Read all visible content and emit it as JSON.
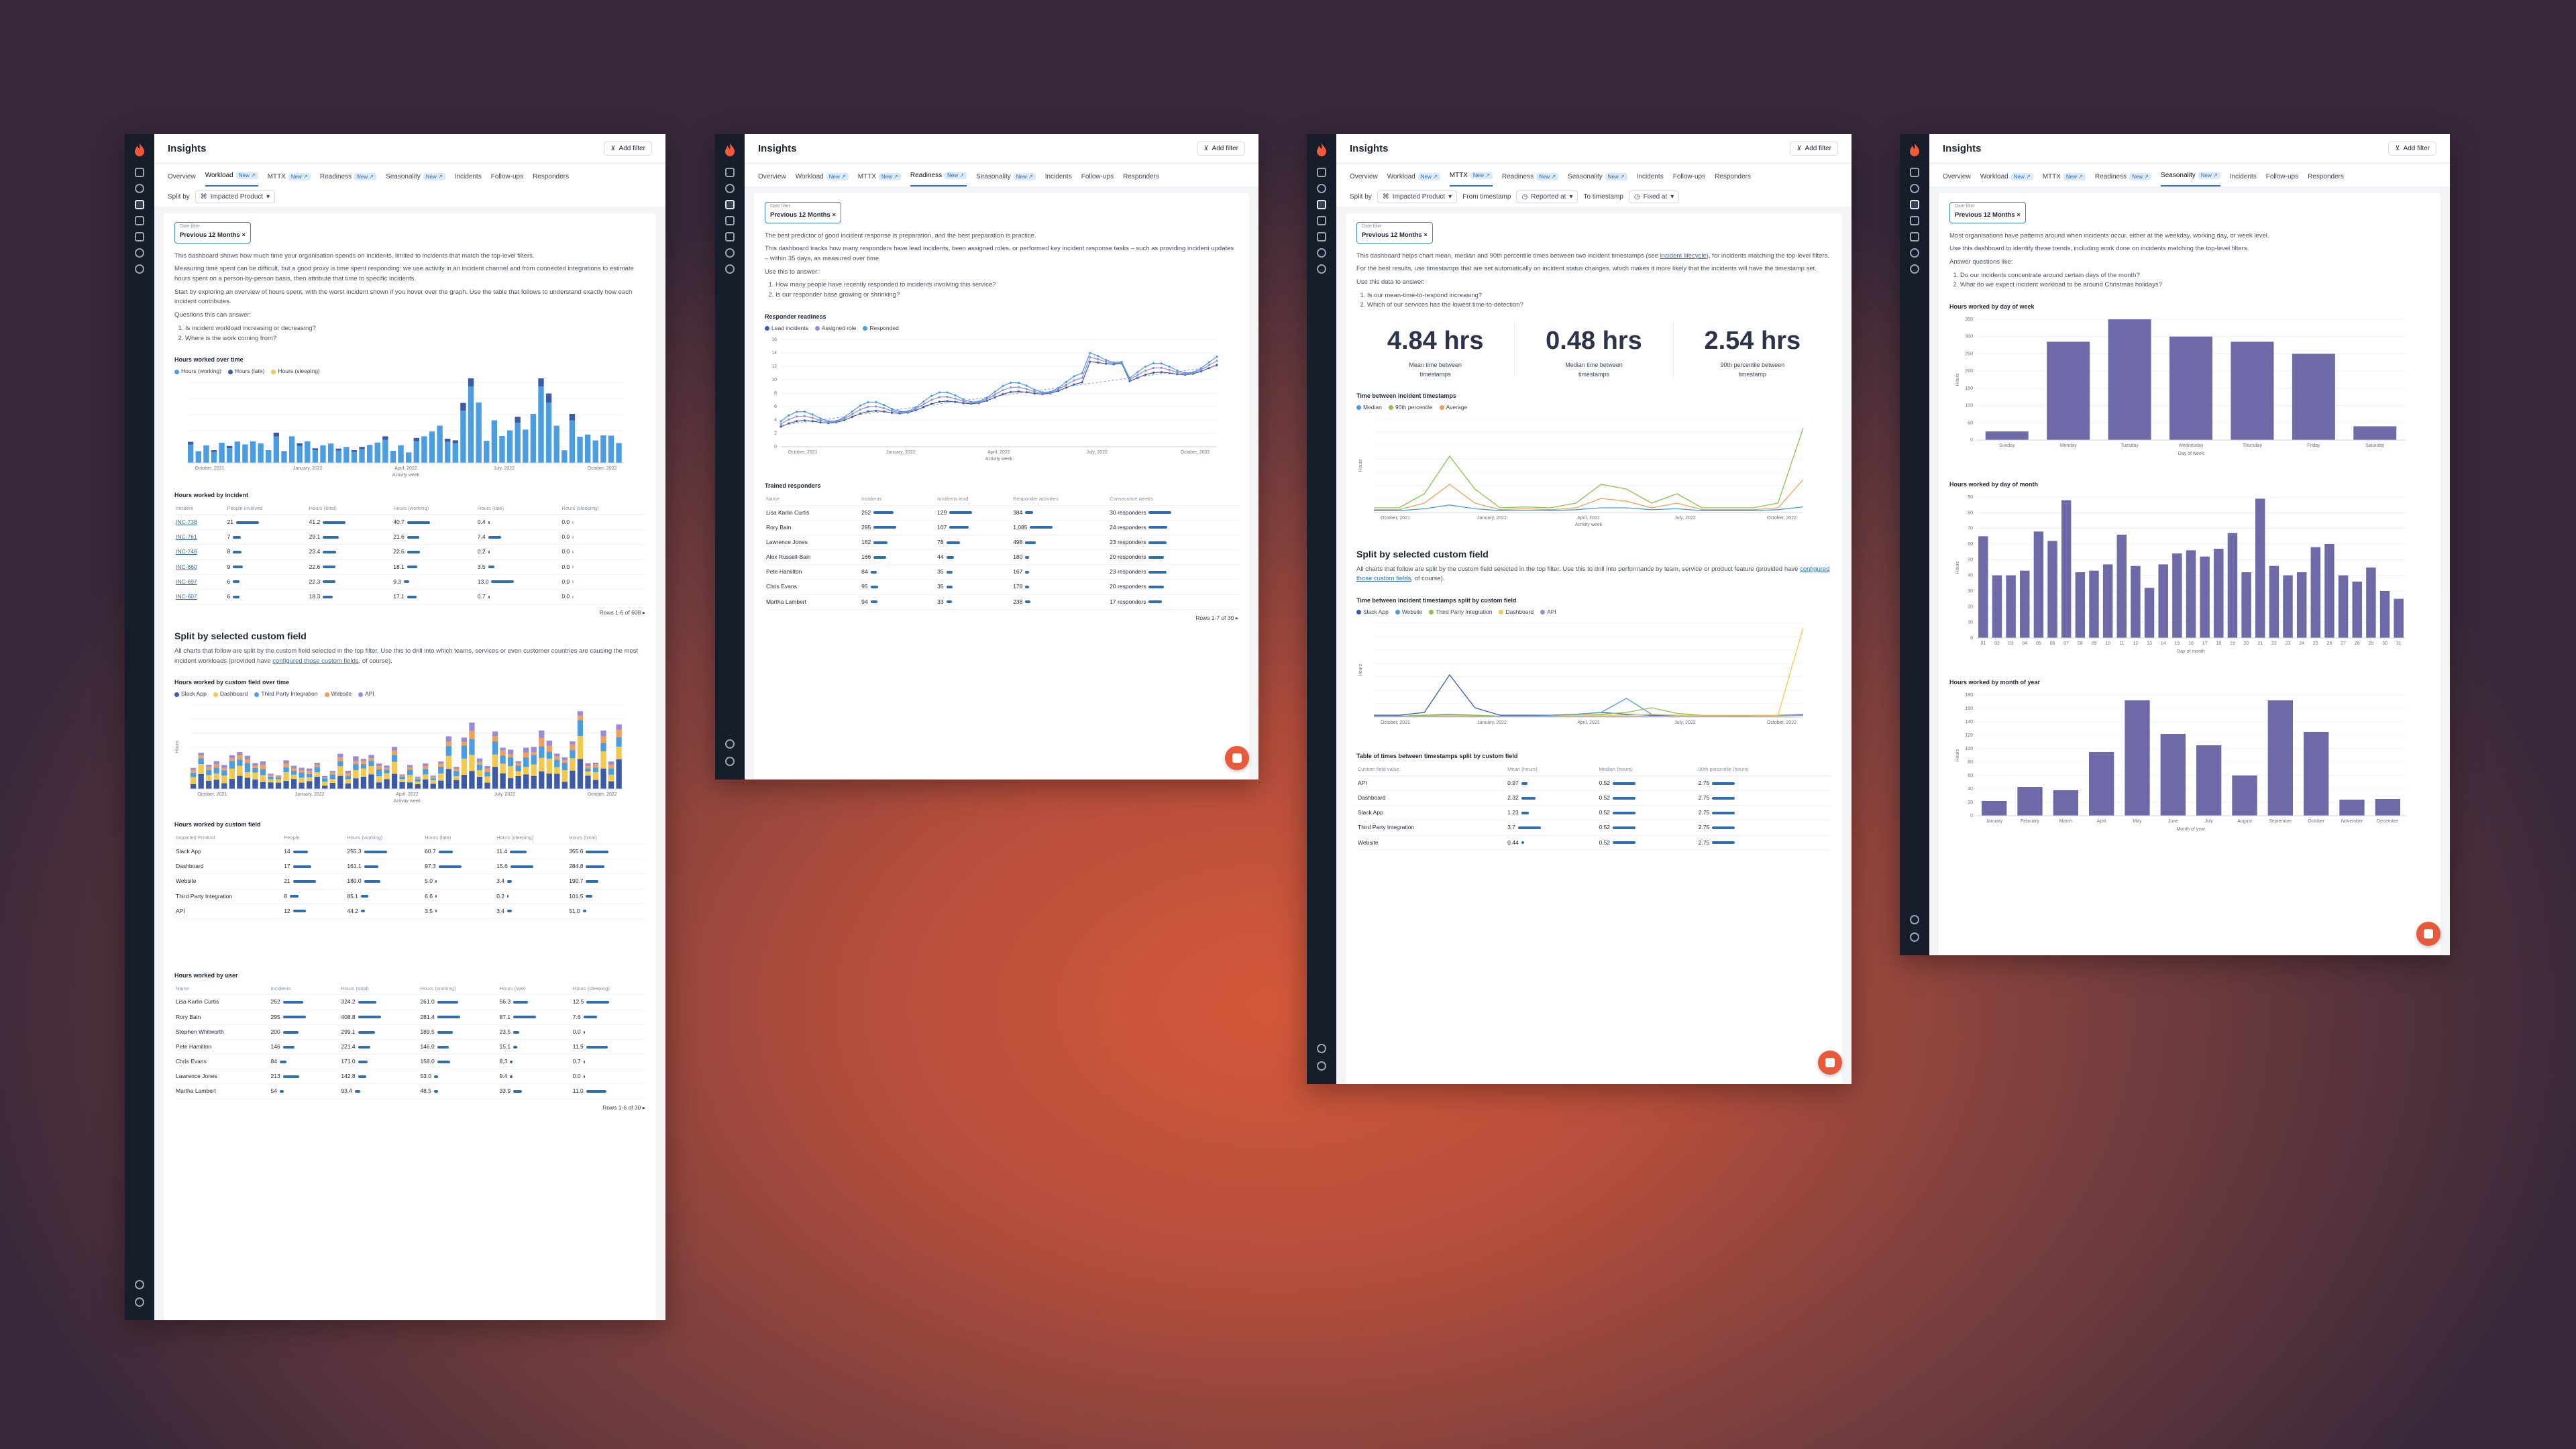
{
  "app": {
    "title": "Insights",
    "add_filter": "Add filter",
    "new_badge": "New ↗",
    "date_filter_label": "Date filter",
    "date_filter_value": "Previous 12 Months"
  },
  "tabs": [
    "Overview",
    "Workload",
    "MTTX",
    "Readiness",
    "Seasonality",
    "Incidents",
    "Follow-ups",
    "Responders"
  ],
  "tabs_new": [
    false,
    true,
    true,
    true,
    true,
    false,
    false,
    false
  ],
  "workload": {
    "split_by_label": "Split by",
    "split_by_value": "Impacted Product",
    "intro": [
      "This dashboard shows how much time your organisation spends on incidents, limited to incidents that match the top-level filters.",
      "Measuring time spent can be difficult, but a good proxy is time spent responding: we use activity in an incident channel and from connected integrations to estimate hours spent on a person-by-person basis, then attribute that time to specific incidents.",
      "Start by exploring an overview of hours spent, with the worst incident shown if you hover over the graph. Use the table that follows to understand exactly how each incident contributes.",
      "Questions this can answer:"
    ],
    "questions": [
      "Is incident workload increasing or decreasing?",
      "Where is the work coming from?"
    ],
    "hours_chart": {
      "title": "Hours worked over time",
      "legend": [
        "Hours (working)",
        "Hours (late)",
        "Hours (sleeping)"
      ],
      "xlabel": "Activity week",
      "xticks": [
        "October, 2021",
        "January, 2022",
        "April, 2022",
        "July, 2022",
        "October, 2022"
      ]
    },
    "incident_table": {
      "title": "Hours worked by incident",
      "cols": [
        "Incident",
        "People involved",
        "Hours (total)",
        "Hours (working)",
        "Hours (late)",
        "Hours (sleeping)"
      ],
      "rows": [
        [
          "INC-738",
          "21",
          "41.2",
          "40.7",
          "0.4",
          "0.0"
        ],
        [
          "INC-761",
          "7",
          "29.1",
          "21.6",
          "7.4",
          "0.0"
        ],
        [
          "INC-748",
          "8",
          "23.4",
          "22.6",
          "0.2",
          "0.0"
        ],
        [
          "INC-660",
          "9",
          "22.6",
          "18.1",
          "3.5",
          "0.0"
        ],
        [
          "INC-697",
          "6",
          "22.3",
          "9.3",
          "13.0",
          "0.0"
        ],
        [
          "INC-607",
          "6",
          "18.3",
          "17.1",
          "0.7",
          "0.0"
        ]
      ],
      "pager": "Rows 1-6 of 608"
    },
    "custom_title": "Split by selected custom field",
    "custom_text_a": "All charts that follow are split by the custom field selected in the top filter. Use this to drill into which teams, services or even customer countries are causing the most incident workloads (provided have ",
    "custom_link": "configured those custom fields",
    "custom_text_b": ", of course).",
    "custom_chart": {
      "title": "Hours worked by custom field over time",
      "legend": [
        "Slack App",
        "Dashboard",
        "Third Party Integration",
        "Website",
        "API"
      ],
      "ylabel": "Hours",
      "xlabel": "Activity week",
      "xticks": [
        "October, 2021",
        "January, 2022",
        "April, 2022",
        "July, 2022",
        "October, 2022"
      ]
    },
    "cf_table": {
      "title": "Hours worked by custom field",
      "cols": [
        "Impacted Product",
        "People",
        "Hours (working)",
        "Hours (late)",
        "Hours (sleeping)",
        "Hours (total)"
      ],
      "rows": [
        [
          "Slack App",
          "14",
          "255.3",
          "60.7",
          "11.4",
          "355.6"
        ],
        [
          "Dashboard",
          "17",
          "161.1",
          "97.3",
          "15.6",
          "284.8"
        ],
        [
          "Website",
          "21",
          "180.0",
          "5.0",
          "3.4",
          "190.7"
        ],
        [
          "Third Party Integration",
          "8",
          "85.1",
          "6.6",
          "0.2",
          "101.5"
        ],
        [
          "API",
          "12",
          "44.2",
          "3.5",
          "3.4",
          "51.0"
        ]
      ]
    },
    "user_table": {
      "title": "Hours worked by user",
      "cols": [
        "Name",
        "Incidents",
        "Hours (total)",
        "Hours (working)",
        "Hours (late)",
        "Hours (sleeping)"
      ],
      "rows": [
        [
          "Lisa Karlin Curtis",
          "262",
          "324.2",
          "261.0",
          "56.3",
          "12.5"
        ],
        [
          "Rory Bain",
          "295",
          "408.8",
          "281.4",
          "87.1",
          "7.6"
        ],
        [
          "Stephen Whitworth",
          "200",
          "299.1",
          "189.5",
          "23.5",
          "0.0"
        ],
        [
          "Pete Hamilton",
          "146",
          "221.4",
          "146.0",
          "15.1",
          "11.9"
        ],
        [
          "Chris Evans",
          "84",
          "171.0",
          "158.0",
          "8.3",
          "0.7"
        ],
        [
          "Lawrence Jones",
          "213",
          "142.8",
          "53.0",
          "9.4",
          "0.0"
        ],
        [
          "Martha Lambert",
          "54",
          "93.4",
          "48.5",
          "33.9",
          "11.0"
        ]
      ],
      "pager": "Rows 1-6 of 30"
    }
  },
  "readiness": {
    "intro": [
      "The best predictor of good incident response is preparation, and the best preparation is practice.",
      "This dashboard tracks how many responders have lead incidents, been assigned roles, or performed key incident response tasks – such as providing incident updates – within 35 days, as measured over time.",
      "Use this to answer:"
    ],
    "questions": [
      "How many people have recently responded to incidents involving this service?",
      "Is our responder base growing or shrinking?"
    ],
    "chart": {
      "title": "Responder readiness",
      "legend": [
        "Lead incidents",
        "Assigned role",
        "Responded"
      ],
      "xlabel": "Activity week",
      "xticks": [
        "October, 2021",
        "January, 2022",
        "April, 2022",
        "July, 2022",
        "October, 2022"
      ],
      "yticks": [
        "0",
        "2",
        "4",
        "6",
        "8",
        "10",
        "12",
        "14",
        "16"
      ]
    },
    "table": {
      "title": "Trained responders",
      "cols": [
        "Name",
        "Incidents",
        "Incidents lead",
        "Responder activities",
        "Consecutive weeks"
      ],
      "rows": [
        [
          "Lisa Karlin Curtis",
          "262",
          "129",
          "384",
          "30 responders"
        ],
        [
          "Rory Bain",
          "295",
          "107",
          "1,085",
          "24 responders"
        ],
        [
          "Lawrence Jones",
          "182",
          "78",
          "498",
          "23 responders"
        ],
        [
          "Alex Russell-Bain",
          "166",
          "44",
          "180",
          "20 responders"
        ],
        [
          "Pete Hamilton",
          "84",
          "35",
          "167",
          "23 responders"
        ],
        [
          "Chris Evans",
          "95",
          "35",
          "178",
          "20 responders"
        ],
        [
          "Martha Lambert",
          "94",
          "33",
          "238",
          "17 responders"
        ]
      ],
      "pager": "Rows 1-7 of 30"
    }
  },
  "mttx": {
    "split_by_label": "Split by",
    "split_by_value": "Impacted Product",
    "from_label": "From timestamp",
    "from_value": "Reported at",
    "to_label": "To timestamp",
    "to_value": "Fixed at",
    "intro_a": "This dashboard helps chart mean, median and 90th percentile times between two incident timestamps (see ",
    "intro_link": "incident lifecycle",
    "intro_b": "), for incidents matching the top-level filters.",
    "intro2": [
      "For the best results, use timestamps that are set automatically on incident status changes, which makes it more likely that the incidents will have the timestamp set.",
      "Use this data to answer:"
    ],
    "questions": [
      "Is our mean-time-to-respond increasing?",
      "Which of our services has the lowest time-to-detection?"
    ],
    "big": [
      {
        "v": "4.84 hrs",
        "l": "Mean time between timestamps"
      },
      {
        "v": "0.48 hrs",
        "l": "Median time between timestamps"
      },
      {
        "v": "2.54 hrs",
        "l": "90th percentile between timestamp"
      }
    ],
    "chart1": {
      "title": "Time between incident timestamps",
      "legend": [
        "Median",
        "90th percentile",
        "Average"
      ],
      "ylabel": "Hours",
      "xlabel": "Activity week",
      "xticks": [
        "October, 2021",
        "January, 2022",
        "April, 2022",
        "July, 2022",
        "October, 2022"
      ]
    },
    "custom_title": "Split by selected custom field",
    "custom_text_a": "All charts that follow are split by the custom field selected in the top filter. Use this to drill into performance by team, service or product feature (provided have ",
    "custom_link": "configured those custom fields",
    "custom_text_b": ", of course).",
    "chart2": {
      "title": "Time between incident timestamps split by custom field",
      "legend": [
        "Slack App",
        "Website",
        "Third Party Integration",
        "Dashboard",
        "API"
      ],
      "ylabel": "Hours",
      "xticks": [
        "October, 2021",
        "January, 2022",
        "April, 2022",
        "July, 2022",
        "October, 2022"
      ]
    },
    "table": {
      "title": "Table of times between timestamps split by custom field",
      "cols": [
        "Custom field value",
        "Mean (hours)",
        "Median (hours)",
        "90th percentile (hours)"
      ],
      "rows": [
        [
          "API",
          "0.97",
          "0.52",
          "2.75"
        ],
        [
          "Dashboard",
          "2.32",
          "0.52",
          "2.75"
        ],
        [
          "Slack App",
          "1.23",
          "0.52",
          "2.75"
        ],
        [
          "Third Party Integration",
          "3.7",
          "0.52",
          "2.75"
        ],
        [
          "Website",
          "0.44",
          "0.52",
          "2.75"
        ]
      ]
    }
  },
  "seasonality": {
    "intro": [
      "Most organisations have patterns around when incidents occur, either at the weekday, working day, or week level.",
      "Use this dashboard to identify these trends, including work done on incidents matching the top-level filters.",
      "Answer questions like:"
    ],
    "questions": [
      "Do our incidents concentrate around certain days of the month?",
      "What do we expect incident workload to be around Christmas holidays?"
    ],
    "dow": {
      "title": "Hours worked by day of week",
      "ylabel": "Hours",
      "xlabel": "Day of week",
      "yticks": [
        "0",
        "50",
        "100",
        "150",
        "200",
        "250",
        "300",
        "350"
      ]
    },
    "dom": {
      "title": "Hours worked by day of month",
      "ylabel": "Hours",
      "xlabel": "Day of month",
      "yticks": [
        "0",
        "10",
        "20",
        "30",
        "40",
        "50",
        "60",
        "70",
        "80",
        "90"
      ]
    },
    "moy": {
      "title": "Hours worked by month of year",
      "ylabel": "Hours",
      "xlabel": "Month of year",
      "yticks": [
        "0",
        "20",
        "40",
        "60",
        "80",
        "100",
        "120",
        "140",
        "160",
        "180"
      ]
    }
  },
  "chart_data": [
    {
      "type": "bar",
      "title": "Hours worked by day of week",
      "categories": [
        "Sunday",
        "Monday",
        "Tuesday",
        "Wednesday",
        "Thursday",
        "Friday",
        "Saturday"
      ],
      "values": [
        25,
        285,
        350,
        300,
        285,
        250,
        40
      ],
      "ylim": [
        0,
        350
      ],
      "ylabel": "Hours",
      "xlabel": "Day of week"
    },
    {
      "type": "bar",
      "title": "Hours worked by day of month",
      "categories": [
        "01",
        "02",
        "03",
        "04",
        "05",
        "06",
        "07",
        "08",
        "09",
        "10",
        "11",
        "12",
        "13",
        "14",
        "15",
        "16",
        "17",
        "18",
        "19",
        "20",
        "21",
        "22",
        "23",
        "24",
        "25",
        "26",
        "27",
        "28",
        "29",
        "30",
        "31"
      ],
      "values": [
        65,
        40,
        40,
        43,
        68,
        62,
        88,
        42,
        43,
        47,
        66,
        46,
        32,
        47,
        54,
        56,
        52,
        57,
        67,
        42,
        89,
        46,
        40,
        42,
        58,
        60,
        40,
        36,
        45,
        30,
        25
      ],
      "ylim": [
        0,
        90
      ],
      "ylabel": "Hours",
      "xlabel": "Day of month"
    },
    {
      "type": "bar",
      "title": "Hours worked by month of year",
      "categories": [
        "January",
        "February",
        "March",
        "April",
        "May",
        "June",
        "July",
        "August",
        "September",
        "October",
        "November",
        "December"
      ],
      "values": [
        22,
        43,
        38,
        95,
        172,
        122,
        105,
        60,
        172,
        125,
        24,
        25
      ],
      "ylim": [
        0,
        180
      ],
      "ylabel": "Hours",
      "xlabel": "Month of year"
    }
  ],
  "colors": {
    "accent": "#2f6fb0",
    "fab": "#e85a3c",
    "purple": "#6e6aa8",
    "blue": "#4a9de0",
    "navy": "#3b5ba9",
    "yellow": "#f2c94c",
    "green": "#8bc34a",
    "orange": "#f0a05a",
    "lilac": "#9b8ad6"
  }
}
